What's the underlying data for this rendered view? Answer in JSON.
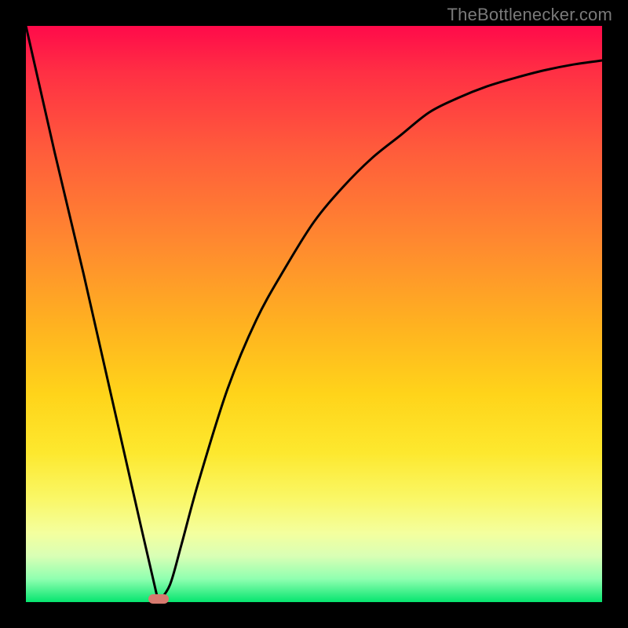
{
  "watermark": "TheBottlenecker.com",
  "colors": {
    "frame": "#000000",
    "gradient_top": "#ff0a4a",
    "gradient_bottom": "#06e56f",
    "curve": "#000000",
    "marker": "#d77a6f"
  },
  "chart_data": {
    "type": "line",
    "title": "",
    "xlabel": "",
    "ylabel": "",
    "xlim": [
      0,
      100
    ],
    "ylim": [
      0,
      100
    ],
    "x": [
      0,
      5,
      10,
      15,
      20,
      23,
      25,
      27,
      30,
      35,
      40,
      45,
      50,
      55,
      60,
      65,
      70,
      75,
      80,
      85,
      90,
      95,
      100
    ],
    "values": [
      100,
      78,
      57,
      35,
      13,
      0,
      3,
      10,
      21,
      37,
      49,
      58,
      66,
      72,
      77,
      81,
      85,
      87.5,
      89.5,
      91,
      92.3,
      93.3,
      94
    ],
    "minimum_at_x": 23,
    "marker": {
      "x": 23,
      "y": 0
    }
  }
}
